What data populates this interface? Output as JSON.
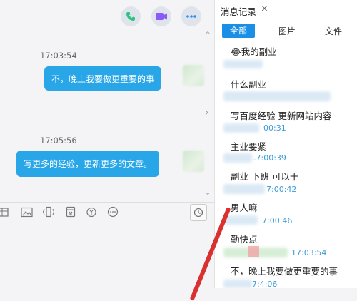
{
  "chat": {
    "messages": [
      {
        "time": "17:03:54",
        "text": "不，晚上我要做更重要的事"
      },
      {
        "time": "17:05:56",
        "text": "写更多的经验，更新更多的文章。"
      }
    ],
    "buttons": [
      "phone-icon",
      "video-icon",
      "more-icon"
    ],
    "toolbar_icons": [
      "file-icon",
      "image-icon",
      "shake-icon",
      "red-packet-icon",
      "transfer-icon",
      "more-icon",
      "history-clock-icon"
    ]
  },
  "history": {
    "title": "消息记录",
    "close_label": "×",
    "filters": [
      "全部",
      "图片",
      "文件"
    ],
    "active_filter": "全部",
    "entries": [
      {
        "kind": "msg",
        "text": "我的副业",
        "emoji": "😂"
      },
      {
        "kind": "msg",
        "text": "什么副业"
      },
      {
        "kind": "msg",
        "text": "写百度经验  更新网站内容"
      },
      {
        "kind": "stamp",
        "text": "00:31"
      },
      {
        "kind": "msg",
        "text": "主业要紧"
      },
      {
        "kind": "stamp",
        "text": ".7:00:39"
      },
      {
        "kind": "msg",
        "text": "副业  下班  可以干"
      },
      {
        "kind": "stamp",
        "text": "7:00:42"
      },
      {
        "kind": "msg",
        "text": "男人嘛"
      },
      {
        "kind": "stamp",
        "text": "7:00:46"
      },
      {
        "kind": "msg",
        "text": "勤快点"
      },
      {
        "kind": "stamp",
        "text": "17:03:54"
      },
      {
        "kind": "msg",
        "text": "不，晚上我要做更重要的事"
      },
      {
        "kind": "stamp",
        "text": "7:4:06"
      }
    ]
  },
  "colors": {
    "bubble": "#28a6e8",
    "accent": "#1a8fe6",
    "phone_icon": "#2ec27e",
    "video_icon": "#8a5cf6",
    "more_icon": "#2d8cf0",
    "timestamp": "#3a9bd6"
  }
}
